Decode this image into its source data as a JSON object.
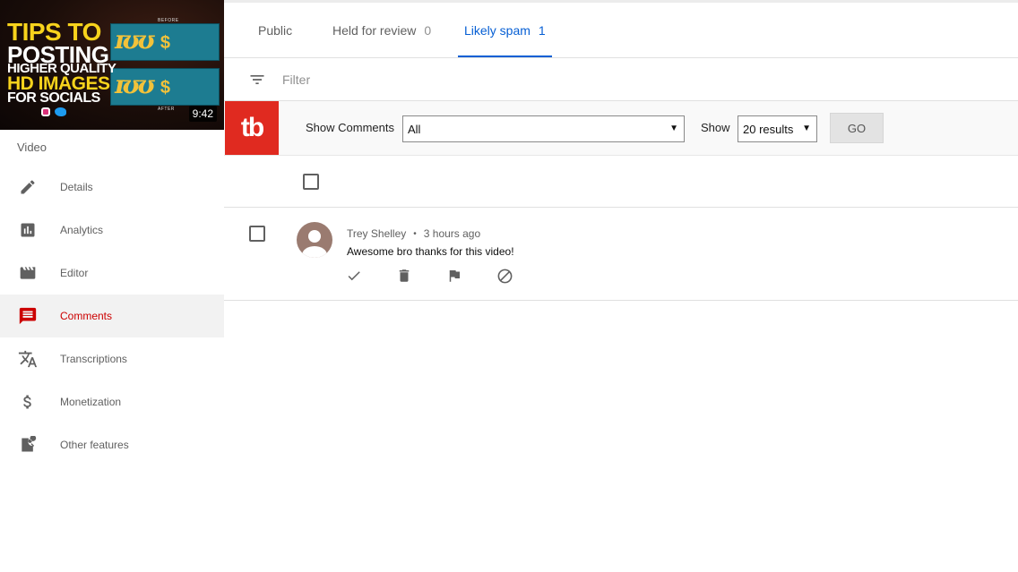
{
  "thumbnail": {
    "title_lines": [
      "TIPS TO",
      "POSTING",
      "HIGHER QUALITY",
      "HD IMAGES",
      "FOR SOCIALS"
    ],
    "before_label": "BEFORE",
    "after_label": "AFTER",
    "duration": "9:42"
  },
  "sidebar": {
    "section_label": "Video",
    "items": [
      {
        "label": "Details",
        "icon": "pencil-icon"
      },
      {
        "label": "Analytics",
        "icon": "bar-chart-icon"
      },
      {
        "label": "Editor",
        "icon": "clapperboard-icon"
      },
      {
        "label": "Comments",
        "icon": "comment-icon",
        "active": true
      },
      {
        "label": "Transcriptions",
        "icon": "translate-icon"
      },
      {
        "label": "Monetization",
        "icon": "dollar-icon"
      },
      {
        "label": "Other features",
        "icon": "other-features-icon"
      }
    ]
  },
  "tabs": [
    {
      "label": "Public",
      "count": ""
    },
    {
      "label": "Held for review",
      "count": "0"
    },
    {
      "label": "Likely spam",
      "count": "1",
      "active": true
    }
  ],
  "filter": {
    "placeholder": "Filter"
  },
  "tubebuddy": {
    "logo": "tb",
    "show_comments_label": "Show Comments",
    "show_comments_value": "All",
    "show_label": "Show",
    "show_value": "20 results",
    "go_label": "GO"
  },
  "comment": {
    "author": "Trey Shelley",
    "separator": "•",
    "time": "3 hours ago",
    "text": "Awesome bro thanks for this video!"
  },
  "colors": {
    "accent_blue": "#065fd4",
    "active_red": "#cc0000",
    "tubebuddy_red": "#e02a20"
  }
}
